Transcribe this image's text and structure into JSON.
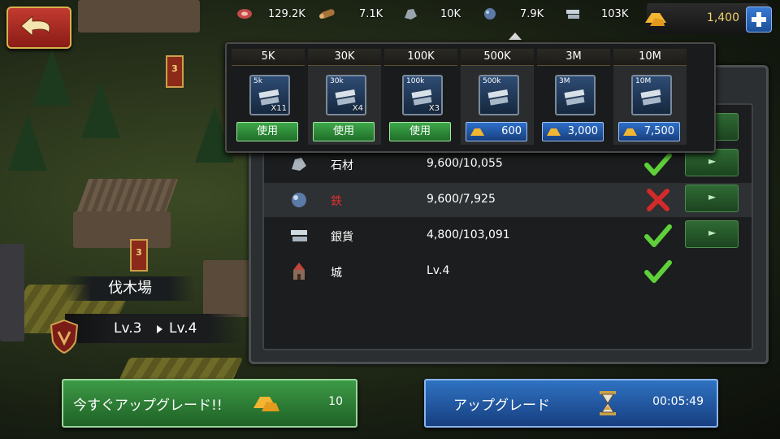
{
  "resources": [
    {
      "name": "meat-icon",
      "value": "129.2K"
    },
    {
      "name": "wood-icon",
      "value": "7.1K"
    },
    {
      "name": "stone-icon",
      "value": "10K"
    },
    {
      "name": "iron-icon",
      "value": "7.9K"
    },
    {
      "name": "silver-icon",
      "value": "103K"
    }
  ],
  "gold": {
    "value": "1,400"
  },
  "popup": {
    "packs": [
      {
        "header": "5K",
        "label": "5k",
        "count": "X11",
        "button": "使用",
        "type": "use"
      },
      {
        "header": "30K",
        "label": "30k",
        "count": "X4",
        "button": "使用",
        "type": "use"
      },
      {
        "header": "100K",
        "label": "100k",
        "count": "X3",
        "button": "使用",
        "type": "use"
      },
      {
        "header": "500K",
        "label": "500k",
        "count": "",
        "button": "600",
        "type": "gold"
      },
      {
        "header": "3M",
        "label": "3M",
        "count": "",
        "button": "3,000",
        "type": "gold"
      },
      {
        "header": "10M",
        "label": "10M",
        "count": "",
        "button": "7,500",
        "type": "gold"
      }
    ]
  },
  "requirements": [
    {
      "icon": "stone-icon",
      "name": "石材",
      "value": "9,600/10,055",
      "met": true,
      "name_color": "#ffffff"
    },
    {
      "icon": "iron-icon",
      "name": "鉄",
      "value": "9,600/7,925",
      "met": false,
      "name_color": "#e03030"
    },
    {
      "icon": "silver-icon",
      "name": "銀貨",
      "value": "4,800/103,091",
      "met": true,
      "name_color": "#ffffff"
    },
    {
      "icon": "castle-icon",
      "name": "城",
      "value": "Lv.4",
      "met": true,
      "name_color": "#ffffff"
    }
  ],
  "building": {
    "name": "伐木場",
    "from_level": "Lv.3",
    "to_level": "Lv.4",
    "banner": "3",
    "banner_top": "3"
  },
  "instant_button": {
    "label": "今すぐアップグレード!!",
    "cost": "10"
  },
  "upgrade_button": {
    "label": "アップグレード",
    "time": "00:05:49"
  },
  "colors": {
    "use_green": "#3ea84a",
    "gold_blue": "#2f6fc8",
    "check_green": "#5fd03a",
    "cross_red": "#d42a2a"
  }
}
